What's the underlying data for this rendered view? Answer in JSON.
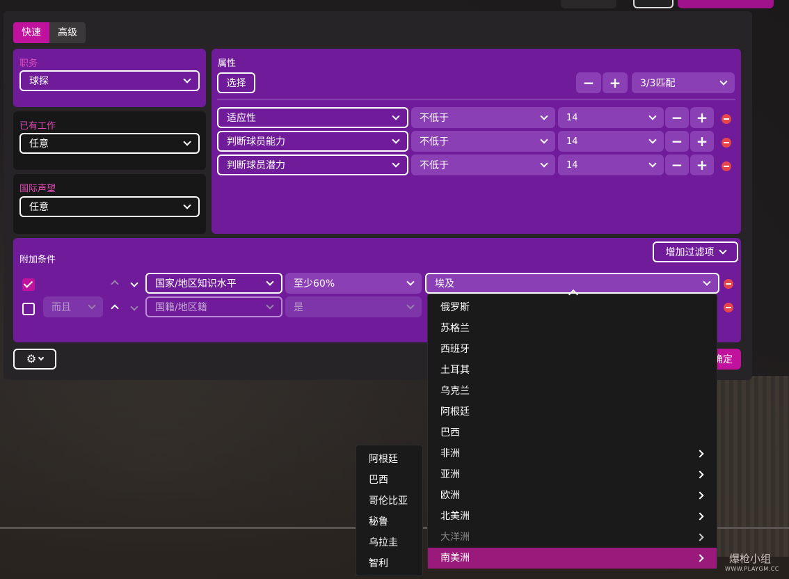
{
  "tabs": [
    {
      "label": "快速",
      "active": true
    },
    {
      "label": "高级",
      "active": false
    }
  ],
  "left_panel": {
    "role": {
      "label": "职务",
      "value": "球探"
    },
    "current_job": {
      "label": "已有工作",
      "value": "任意"
    },
    "reputation": {
      "label": "国际声望",
      "value": "任意"
    }
  },
  "attributes": {
    "label": "属性",
    "select_button": "选择",
    "match_count": "3/3匹配",
    "rows": [
      {
        "attribute": "适应性",
        "comparator": "不低于",
        "value": "14"
      },
      {
        "attribute": "判断球员能力",
        "comparator": "不低于",
        "value": "14"
      },
      {
        "attribute": "判断球员潜力",
        "comparator": "不低于",
        "value": "14"
      }
    ]
  },
  "additional": {
    "label": "附加条件",
    "add_filter_button": "增加过滤项",
    "rows": [
      {
        "checked": true,
        "logic": "",
        "field": "国家/地区知识水平",
        "comparator": "至少60%",
        "value": "埃及"
      },
      {
        "checked": false,
        "logic": "而且",
        "field": "国籍/地区籍",
        "comparator": "是",
        "value": ""
      }
    ]
  },
  "confirm_button": "确定",
  "country_menu": {
    "items": [
      {
        "label": "俄罗斯",
        "submenu": false,
        "muted": false,
        "highlight": false
      },
      {
        "label": "苏格兰",
        "submenu": false,
        "muted": false,
        "highlight": false
      },
      {
        "label": "西班牙",
        "submenu": false,
        "muted": false,
        "highlight": false
      },
      {
        "label": "土耳其",
        "submenu": false,
        "muted": false,
        "highlight": false
      },
      {
        "label": "乌克兰",
        "submenu": false,
        "muted": false,
        "highlight": false
      },
      {
        "label": "阿根廷",
        "submenu": false,
        "muted": false,
        "highlight": false
      },
      {
        "label": "巴西",
        "submenu": false,
        "muted": false,
        "highlight": false
      },
      {
        "label": "非洲",
        "submenu": true,
        "muted": false,
        "highlight": false
      },
      {
        "label": "亚洲",
        "submenu": true,
        "muted": false,
        "highlight": false
      },
      {
        "label": "欧洲",
        "submenu": true,
        "muted": false,
        "highlight": false
      },
      {
        "label": "北美洲",
        "submenu": true,
        "muted": false,
        "highlight": false
      },
      {
        "label": "大洋洲",
        "submenu": true,
        "muted": true,
        "highlight": false
      },
      {
        "label": "南美洲",
        "submenu": true,
        "muted": false,
        "highlight": true
      }
    ]
  },
  "submenu": {
    "items": [
      "阿根廷",
      "巴西",
      "哥伦比亚",
      "秘鲁",
      "乌拉圭",
      "智利"
    ]
  },
  "watermark": {
    "text": "爆枪小组",
    "sub": "WWW.PLAYGM.CC"
  },
  "colors": {
    "accent": "#c0129d",
    "panel_purple": "#6f1b9a",
    "remove_red": "#e5454d"
  }
}
